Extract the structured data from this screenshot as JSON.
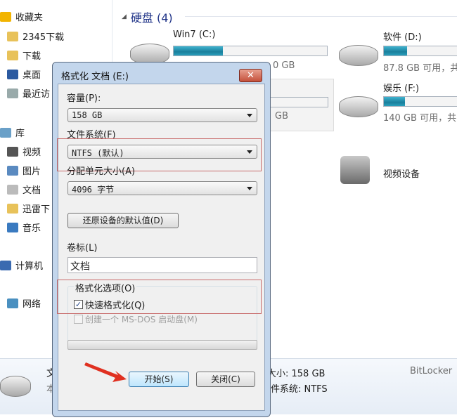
{
  "sidebar": {
    "items": [
      {
        "label": "收藏夹",
        "icon": "star-icon"
      },
      {
        "label": "2345下载",
        "icon": "folder-icon"
      },
      {
        "label": "下载",
        "icon": "downloads-folder-icon"
      },
      {
        "label": "桌面",
        "icon": "desktop-icon"
      },
      {
        "label": "最近访",
        "icon": "recent-places-icon"
      },
      {
        "label": "库",
        "icon": "library-icon"
      },
      {
        "label": "视频",
        "icon": "video-icon"
      },
      {
        "label": "图片",
        "icon": "pictures-icon"
      },
      {
        "label": "文档",
        "icon": "documents-icon"
      },
      {
        "label": "迅雷下",
        "icon": "folder-icon"
      },
      {
        "label": "音乐",
        "icon": "music-icon"
      },
      {
        "label": "计算机",
        "icon": "computer-icon"
      },
      {
        "label": "网络",
        "icon": "network-icon"
      }
    ]
  },
  "main": {
    "section_title": "硬盘 (4)",
    "drives": [
      {
        "name": "Win7 (C:)",
        "free": "0 GB",
        "used_fraction": 0.32
      },
      {
        "name": "软件 (D:)",
        "free": "87.8 GB 可用，共",
        "used_fraction": 0.28
      },
      {
        "name": "",
        "free": "GB",
        "used_fraction": 0
      },
      {
        "name": "娱乐 (F:)",
        "free": "140 GB 可用，共",
        "used_fraction": 0.25
      }
    ],
    "device": "视频设备"
  },
  "details": {
    "name": "文",
    "type": "本",
    "size": "大小: 158 GB",
    "fs": "文件系统: NTFS",
    "bitlocker": "BitLocker"
  },
  "dialog": {
    "title": "格式化 文档 (E:)",
    "close": "✕",
    "capacity_label": "容量(P):",
    "capacity_value": "158 GB",
    "fs_label": "文件系统(F)",
    "fs_value": "NTFS (默认)",
    "alloc_label": "分配单元大小(A)",
    "alloc_value": "4096 字节",
    "restore_button": "还原设备的默认值(D)",
    "volume_label": "卷标(L)",
    "volume_value": "文档",
    "options_label": "格式化选项(O)",
    "quick_format": "快速格式化(Q)",
    "quick_format_checked": true,
    "msdos": "创建一个 MS-DOS 启动盘(M)",
    "msdos_checked": false,
    "progress": 0,
    "start_button": "开始(S)",
    "close_button": "关闭(C)"
  }
}
